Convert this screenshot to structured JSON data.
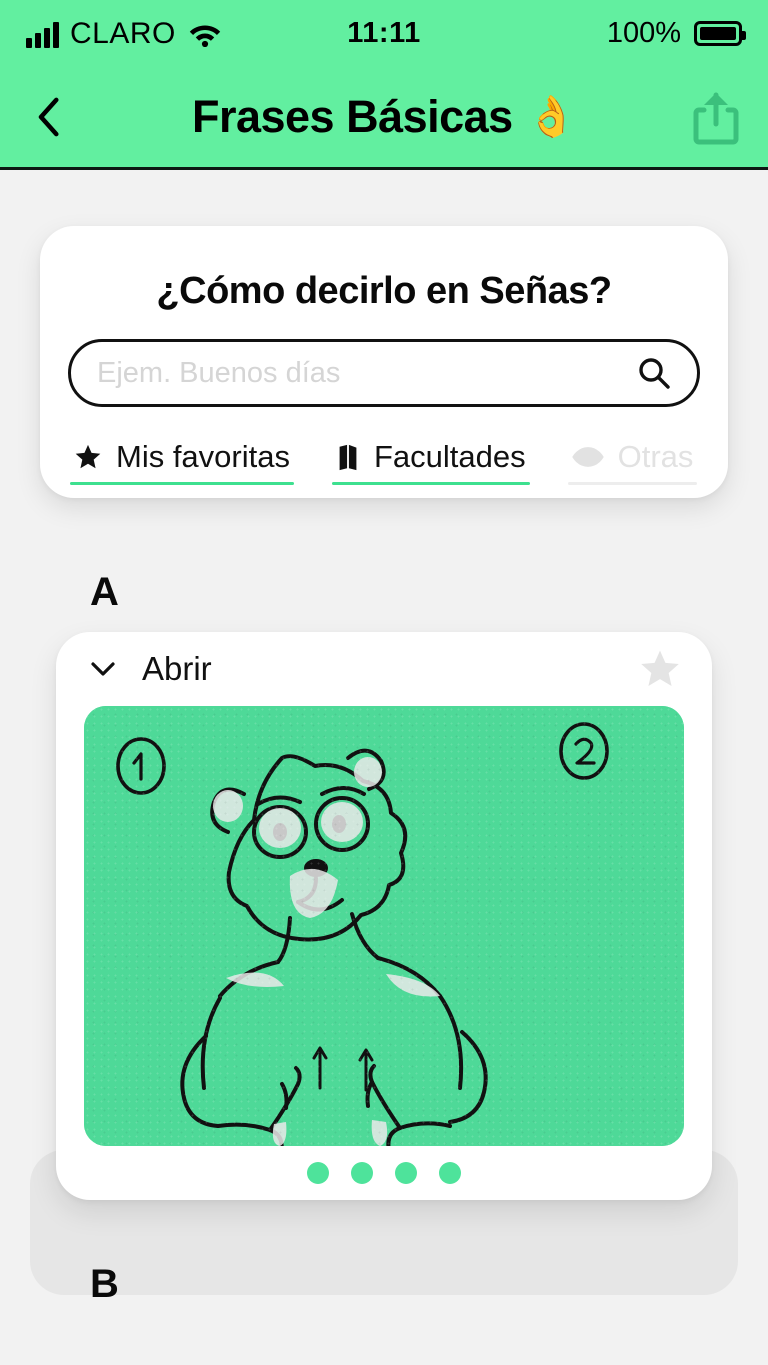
{
  "status_bar": {
    "carrier": "CLARO",
    "signal_icon": "signal-bars-icon",
    "wifi_icon": "wifi-icon",
    "time": "11:11",
    "battery_percent": "100%",
    "battery_icon": "battery-full-icon"
  },
  "nav": {
    "back_icon": "chevron-left-icon",
    "title": "Frases Básicas",
    "title_emoji": "👌",
    "share_icon": "share-icon"
  },
  "search": {
    "heading": "¿Cómo decirlo en Señas?",
    "placeholder": "Ejem. Buenos días",
    "value": "",
    "search_icon": "search-icon",
    "tabs": [
      {
        "label": "Mis favoritas",
        "icon": "star-icon",
        "active": true
      },
      {
        "label": "Facultades",
        "icon": "map-icon",
        "active": true
      },
      {
        "label": "Otras",
        "icon": "eye-icon",
        "active": false
      }
    ]
  },
  "sections": [
    {
      "letter": "A"
    },
    {
      "letter": "B"
    }
  ],
  "phrase_card": {
    "expand_icon": "chevron-down-icon",
    "title": "Abrir",
    "favorite_icon": "star-icon",
    "illustration_alt": "Ilustración de seña",
    "slide_numbers": [
      "1",
      "2"
    ],
    "pagination_count": 4
  },
  "colors": {
    "header_green": "#62efa0",
    "illustration_green": "#4ed998",
    "accent_green": "#3de08f",
    "dot_green": "#4ee39b",
    "page_background": "#f2f2f2",
    "panel_gray": "#e6e6e6",
    "card_white": "#ffffff",
    "text_black": "#0a0a0a",
    "muted_gray": "#e2e2e2"
  }
}
